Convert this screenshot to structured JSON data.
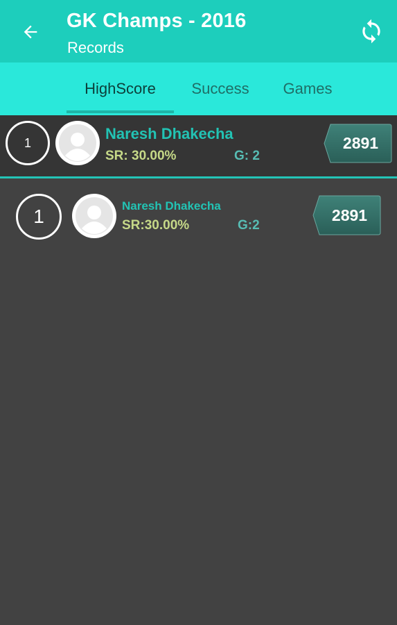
{
  "appbar": {
    "title": "GK Champs - 2016",
    "subtitle": "Records",
    "back_icon": "arrow-back-icon",
    "refresh_icon": "refresh-icon"
  },
  "tabs": [
    {
      "label": "HighScore",
      "active": true
    },
    {
      "label": "Success",
      "active": false
    },
    {
      "label": "Games",
      "active": false
    }
  ],
  "colors": {
    "appbar": "#1dcebc",
    "tabbar": "#2ae8da",
    "background": "#424242",
    "accent": "#22c3b4",
    "score_badge": "#2f6b63"
  },
  "highlighted_entry": {
    "rank": "1",
    "name": "Naresh Dhakecha",
    "sr": "SR: 30.00%",
    "games": "G: 2",
    "score": "2891"
  },
  "entries": [
    {
      "rank": "1",
      "name": "Naresh Dhakecha",
      "sr": "SR:30.00%",
      "games": "G:2",
      "score": "2891"
    }
  ]
}
